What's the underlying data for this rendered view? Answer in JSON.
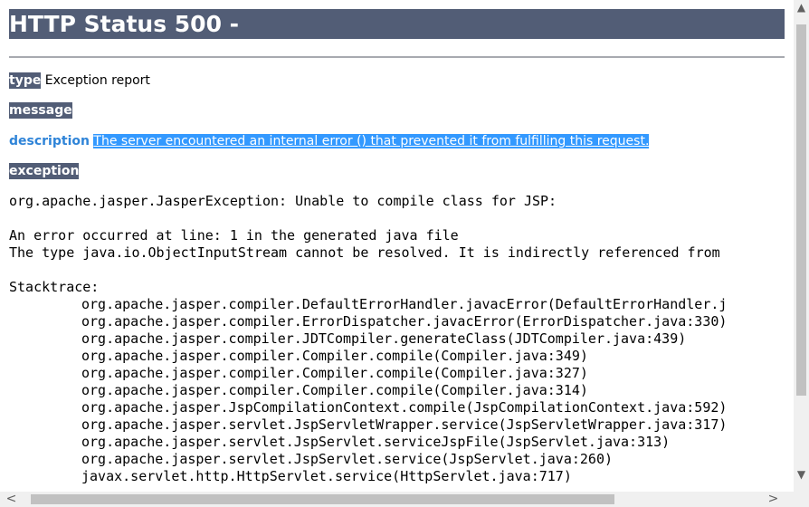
{
  "page": {
    "title": "HTTP Status 500 -"
  },
  "fields": {
    "type_label": "type",
    "type_value": "Exception report",
    "message_label": "message",
    "description_label": "description",
    "description_value": "The server encountered an internal error () that prevented it from fulfilling this request.",
    "exception_label": "exception"
  },
  "exception": {
    "line1": "org.apache.jasper.JasperException: Unable to compile class for JSP:",
    "line2": "",
    "line3": "An error occurred at line: 1 in the generated java file",
    "line4": "The type java.io.ObjectInputStream cannot be resolved. It is indirectly referenced from",
    "line5": "",
    "stacktrace_label": "Stacktrace:",
    "frames": [
      "org.apache.jasper.compiler.DefaultErrorHandler.javacError(DefaultErrorHandler.j",
      "org.apache.jasper.compiler.ErrorDispatcher.javacError(ErrorDispatcher.java:330)",
      "org.apache.jasper.compiler.JDTCompiler.generateClass(JDTCompiler.java:439)",
      "org.apache.jasper.compiler.Compiler.compile(Compiler.java:349)",
      "org.apache.jasper.compiler.Compiler.compile(Compiler.java:327)",
      "org.apache.jasper.compiler.Compiler.compile(Compiler.java:314)",
      "org.apache.jasper.JspCompilationContext.compile(JspCompilationContext.java:592)",
      "org.apache.jasper.servlet.JspServletWrapper.service(JspServletWrapper.java:317)",
      "org.apache.jasper.servlet.JspServlet.serviceJspFile(JspServlet.java:313)",
      "org.apache.jasper.servlet.JspServlet.service(JspServlet.java:260)",
      "javax.servlet.http.HttpServlet.service(HttpServlet.java:717)"
    ]
  },
  "scrollbars": {
    "up_arrow": "▲",
    "down_arrow": "▼",
    "left_arrow": "<",
    "right_arrow": ">"
  },
  "colors": {
    "header_bg": "#525d76",
    "selection_bg": "#3399ff",
    "description_label": "#2f84d8"
  }
}
